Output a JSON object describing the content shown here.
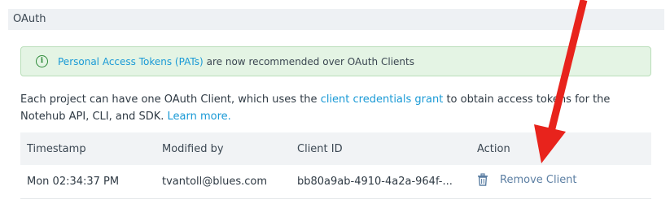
{
  "section": {
    "title": "OAuth"
  },
  "alert": {
    "icon": "info-icon",
    "link_text": "Personal Access Tokens (PATs)",
    "rest_text": "are now recommended over OAuth Clients",
    "link_color": "#1a9ad6"
  },
  "description": {
    "text_before": "Each project can have one OAuth Client, which uses the ",
    "link_grant": "client credentials grant",
    "text_after": " to obtain access tokens for the Notehub API, CLI, and SDK. ",
    "link_learn": "Learn more."
  },
  "table": {
    "headers": [
      "Timestamp",
      "Modified by",
      "Client ID",
      "Action"
    ],
    "rows": [
      {
        "timestamp": "Mon 02:34:37 PM",
        "modified_by": "tvantoll@blues.com",
        "client_id": "bb80a9ab-4910-4a2a-964f-...",
        "action_label": "Remove Client",
        "action_icon": "trash-icon"
      }
    ]
  },
  "annotation": {
    "type": "arrow",
    "color": "#e8231c"
  }
}
